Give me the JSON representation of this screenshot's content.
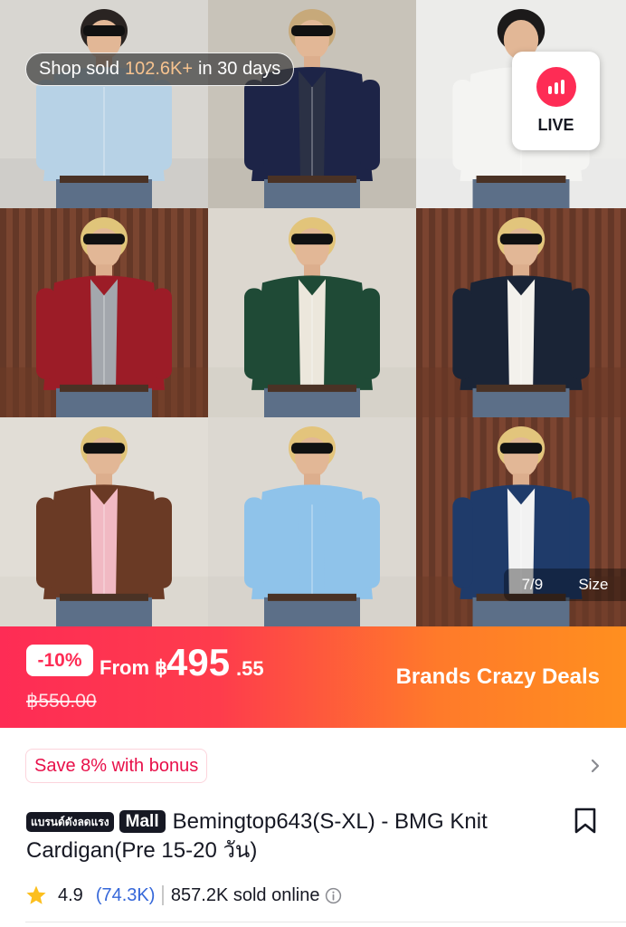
{
  "gallery": {
    "sold_prefix": "Shop sold",
    "sold_value": "102.6K+",
    "sold_suffix": "in 30 days",
    "live_label": "LIVE",
    "image_index": "7/9",
    "size_label": "Size",
    "tiles": [
      {
        "bg": "#c9c7c2",
        "cardigan": "#b7d2e6",
        "shirt": "#b7d2e6",
        "hair": "#2a2422",
        "wall": "#d8d6d1"
      },
      {
        "bg": "#bdb8ae",
        "cardigan": "#1d2447",
        "shirt": "#2b3145",
        "hair": "#c7a97a",
        "wall": "#c8c3b9"
      },
      {
        "bg": "#e9e9e7",
        "cardigan": "#f4f4f2",
        "shirt": "#f4f4f2",
        "hair": "#1c1a1a",
        "wall": "#ececea"
      },
      {
        "bg": "#6b3a26",
        "cardigan": "#9c1c27",
        "shirt": "#a3a7ad",
        "hair": "#e0c57a",
        "wall": "#7a4530"
      },
      {
        "bg": "#d2cdc5",
        "cardigan": "#1f4a36",
        "shirt": "#ece7dc",
        "hair": "#e2c47a",
        "wall": "#dcd7cf"
      },
      {
        "bg": "#6a3926",
        "cardigan": "#1a2436",
        "shirt": "#f3f1ec",
        "hair": "#e2c57c",
        "wall": "#7b4430"
      },
      {
        "bg": "#d9d4cc",
        "cardigan": "#6a3a25",
        "shirt": "#f1b9c3",
        "hair": "#e0c47a",
        "wall": "#e1ddd6"
      },
      {
        "bg": "#d3cfc8",
        "cardigan": "#8fc3ea",
        "shirt": "#8fc3ea",
        "hair": "#e3c47c",
        "wall": "#dcd8d1"
      },
      {
        "bg": "#6c3a27",
        "cardigan": "#1f3b6a",
        "shirt": "#f2f2f2",
        "hair": "#e2c57c",
        "wall": "#7c4531"
      }
    ]
  },
  "price": {
    "discount": "-10%",
    "from_label": "From",
    "currency": "฿",
    "amount_main": "495",
    "amount_decimal": ".55",
    "original": "฿550.00",
    "deal_label": "Brands Crazy Deals"
  },
  "bonus": {
    "label": "Save 8% with bonus"
  },
  "product": {
    "brand_badge": "แบรนด์ดังลดแรง",
    "mall_badge": "Mall",
    "title": "Bemingtop643(S-XL)  - BMG Knit Cardigan(Pre 15-20 วัน)"
  },
  "rating": {
    "score": "4.9",
    "count": "(74.3K)",
    "sold": "857.2K sold online"
  },
  "colors": {
    "accent": "#fe2c55",
    "deal_orange": "#ff8f1f",
    "link_blue": "#3567d9",
    "star": "#fcbf1e"
  }
}
